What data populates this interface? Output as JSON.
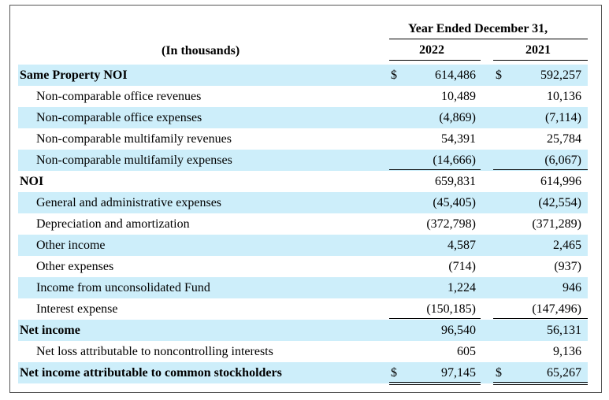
{
  "header": {
    "year_title": "Year Ended December 31,",
    "units": "(In thousands)",
    "col_2022": "2022",
    "col_2021": "2021"
  },
  "rows": [
    {
      "label": "Same Property NOI",
      "bold": true,
      "indent": false,
      "shade": true,
      "d22": "$",
      "v22": "614,486",
      "d21": "$",
      "v21": "592,257"
    },
    {
      "label": "Non-comparable office revenues",
      "bold": false,
      "indent": true,
      "shade": false,
      "d22": "",
      "v22": "10,489",
      "d21": "",
      "v21": "10,136"
    },
    {
      "label": "Non-comparable office expenses",
      "bold": false,
      "indent": true,
      "shade": true,
      "d22": "",
      "v22": "(4,869)",
      "d21": "",
      "v21": "(7,114)"
    },
    {
      "label": "Non-comparable multifamily revenues",
      "bold": false,
      "indent": true,
      "shade": false,
      "d22": "",
      "v22": "54,391",
      "d21": "",
      "v21": "25,784"
    },
    {
      "label": "Non-comparable multifamily expenses",
      "bold": false,
      "indent": true,
      "shade": true,
      "d22": "",
      "v22": "(14,666)",
      "d21": "",
      "v21": "(6,067)"
    },
    {
      "label": "NOI",
      "bold": true,
      "indent": false,
      "shade": false,
      "d22": "",
      "v22": "659,831",
      "d21": "",
      "v21": "614,996"
    },
    {
      "label": "General and administrative expenses",
      "bold": false,
      "indent": true,
      "shade": true,
      "d22": "",
      "v22": "(45,405)",
      "d21": "",
      "v21": "(42,554)"
    },
    {
      "label": "Depreciation and amortization",
      "bold": false,
      "indent": true,
      "shade": false,
      "d22": "",
      "v22": "(372,798)",
      "d21": "",
      "v21": "(371,289)"
    },
    {
      "label": "Other income",
      "bold": false,
      "indent": true,
      "shade": true,
      "d22": "",
      "v22": "4,587",
      "d21": "",
      "v21": "2,465"
    },
    {
      "label": "Other expenses",
      "bold": false,
      "indent": true,
      "shade": false,
      "d22": "",
      "v22": "(714)",
      "d21": "",
      "v21": "(937)"
    },
    {
      "label": "Income from unconsolidated Fund",
      "bold": false,
      "indent": true,
      "shade": true,
      "d22": "",
      "v22": "1,224",
      "d21": "",
      "v21": "946"
    },
    {
      "label": "Interest expense",
      "bold": false,
      "indent": true,
      "shade": false,
      "d22": "",
      "v22": "(150,185)",
      "d21": "",
      "v21": "(147,496)"
    },
    {
      "label": "Net income",
      "bold": true,
      "indent": false,
      "shade": true,
      "d22": "",
      "v22": "96,540",
      "d21": "",
      "v21": "56,131"
    },
    {
      "label": "Net loss attributable to noncontrolling interests",
      "bold": false,
      "indent": true,
      "shade": false,
      "d22": "",
      "v22": "605",
      "d21": "",
      "v21": "9,136"
    },
    {
      "label": "Net income attributable to common stockholders",
      "bold": true,
      "indent": false,
      "shade": true,
      "d22": "$",
      "v22": "97,145",
      "d21": "$",
      "v21": "65,267"
    }
  ]
}
